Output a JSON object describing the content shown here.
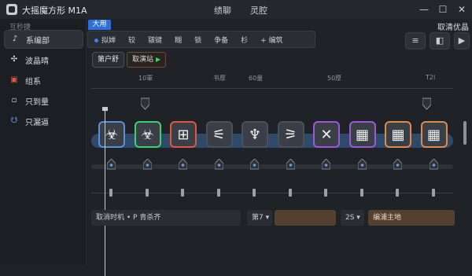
{
  "titlebar": {
    "title": "大摇魔方形 M1A",
    "menu": [
      "绩聊",
      "灵腔"
    ],
    "controls": {
      "minimize": "—",
      "maximize": "☐",
      "close": "✕"
    }
  },
  "sidebar": {
    "header": "互秒捷",
    "items": [
      {
        "label": "系编部",
        "icon": "music-note-icon",
        "active": true
      },
      {
        "label": "波晶晴",
        "icon": "sparkle-icon",
        "active": false
      },
      {
        "label": "组系",
        "icon": "robot-icon",
        "active": false
      },
      {
        "label": "只到量",
        "icon": "square-icon",
        "active": false
      },
      {
        "label": "只漏逼",
        "icon": "bug-icon",
        "active": false
      }
    ]
  },
  "main": {
    "tag": "大用",
    "top_right": "取清优晶",
    "tabs": [
      "拟婵",
      "较",
      "皲键",
      "糊",
      "锁",
      "争备",
      "杉",
      "+ 编筑"
    ],
    "toolbar_buttons": [
      "≡",
      "◧",
      "▶"
    ],
    "btn_user": "第户舒",
    "btn_action": "取演站",
    "ruler_labels": [
      "10軍",
      "书厚",
      "60量",
      "50厚",
      "T2l"
    ],
    "bottom": {
      "field_left": "取消时机 • P 青杀齐",
      "field_mid_label": "第7 ▾",
      "field_mid_value": "",
      "field_right_label": "2S ▾",
      "field_right_value": "编浦主地"
    }
  },
  "colors": {
    "accent": "#3b82f6",
    "card_green": "#3bd16f",
    "card_red": "#e0573d",
    "card_purple": "#9b59d6",
    "card_orange": "#e08a4a",
    "track_band": "#2d4a6b"
  },
  "cards": [
    {
      "name": "card-1",
      "glyph": "☣",
      "border": "#5d8fd6"
    },
    {
      "name": "card-2",
      "glyph": "☣",
      "border": "#3bd16f"
    },
    {
      "name": "card-3",
      "glyph": "⊞",
      "border": "#e0573d"
    },
    {
      "name": "card-4",
      "glyph": "⚟",
      "border": "#4a5059"
    },
    {
      "name": "card-5",
      "glyph": "♆",
      "border": "#4a5059"
    },
    {
      "name": "card-6",
      "glyph": "⚞",
      "border": "#4a5059"
    },
    {
      "name": "card-7",
      "glyph": "✕",
      "border": "#9b59d6"
    },
    {
      "name": "card-8",
      "glyph": "▦",
      "border": "#9b59d6"
    },
    {
      "name": "card-9",
      "glyph": "▦",
      "border": "#e08a4a"
    },
    {
      "name": "card-10",
      "glyph": "▦",
      "border": "#e08a4a"
    }
  ]
}
